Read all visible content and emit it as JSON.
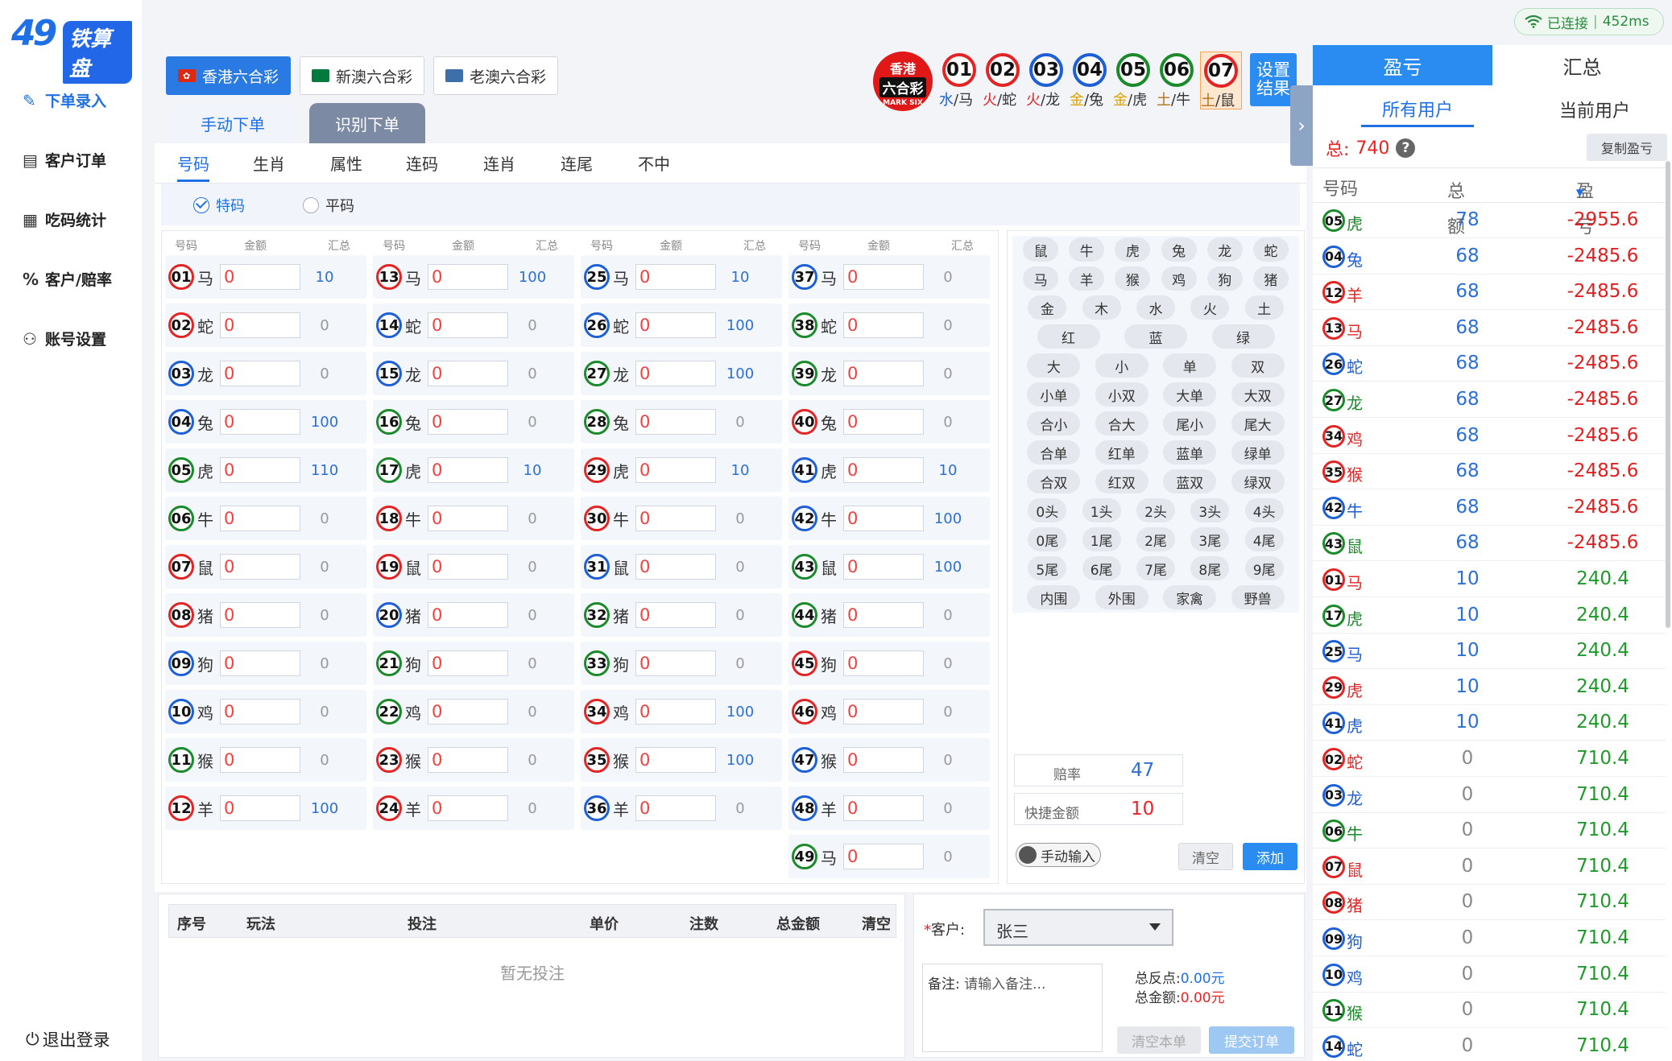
{
  "brand": {
    "logo_mark": "49",
    "logo_text": "铁算盘"
  },
  "nav": [
    {
      "label": "下单录入",
      "icon": "edit-icon"
    },
    {
      "label": "客户订单",
      "icon": "clipboard-icon"
    },
    {
      "label": "吃码统计",
      "icon": "chart-icon"
    },
    {
      "label": "客户/赔率",
      "icon": "percent-icon"
    },
    {
      "label": "账号设置",
      "icon": "user-icon"
    }
  ],
  "logout": "退出登录",
  "status": {
    "connected": "已连接",
    "latency": "452ms"
  },
  "lotteries": [
    "香港六合彩",
    "新澳六合彩",
    "老澳六合彩"
  ],
  "modes": [
    "手动下单",
    "识别下单"
  ],
  "draw": {
    "badge_top": "香港",
    "badge_mid": "六合彩",
    "badge_bottom": "MARK SIX",
    "balls": [
      {
        "n": "01",
        "c": "red",
        "e": "水",
        "z": "马"
      },
      {
        "n": "02",
        "c": "red",
        "e": "火",
        "z": "蛇"
      },
      {
        "n": "03",
        "c": "blue",
        "e": "火",
        "z": "龙"
      },
      {
        "n": "04",
        "c": "blue",
        "e": "金",
        "z": "兔"
      },
      {
        "n": "05",
        "c": "green",
        "e": "金",
        "z": "虎"
      },
      {
        "n": "06",
        "c": "green",
        "e": "土",
        "z": "牛"
      },
      {
        "n": "07",
        "c": "red",
        "e": "土",
        "z": "鼠"
      }
    ],
    "set_result": "设置结果"
  },
  "subtabs": [
    "号码",
    "生肖",
    "属性",
    "连码",
    "连肖",
    "连尾",
    "不中"
  ],
  "radios": [
    "特码",
    "平码"
  ],
  "grid": {
    "headers": [
      "号码",
      "金额",
      "汇总"
    ],
    "amount_default": "0",
    "columns": [
      [
        {
          "n": "01",
          "c": "red",
          "z": "马",
          "s": "10"
        },
        {
          "n": "02",
          "c": "red",
          "z": "蛇",
          "s": "0"
        },
        {
          "n": "03",
          "c": "blue",
          "z": "龙",
          "s": "0"
        },
        {
          "n": "04",
          "c": "blue",
          "z": "兔",
          "s": "100"
        },
        {
          "n": "05",
          "c": "green",
          "z": "虎",
          "s": "110"
        },
        {
          "n": "06",
          "c": "green",
          "z": "牛",
          "s": "0"
        },
        {
          "n": "07",
          "c": "red",
          "z": "鼠",
          "s": "0"
        },
        {
          "n": "08",
          "c": "red",
          "z": "猪",
          "s": "0"
        },
        {
          "n": "09",
          "c": "blue",
          "z": "狗",
          "s": "0"
        },
        {
          "n": "10",
          "c": "blue",
          "z": "鸡",
          "s": "0"
        },
        {
          "n": "11",
          "c": "green",
          "z": "猴",
          "s": "0"
        },
        {
          "n": "12",
          "c": "red",
          "z": "羊",
          "s": "100"
        }
      ],
      [
        {
          "n": "13",
          "c": "red",
          "z": "马",
          "s": "100"
        },
        {
          "n": "14",
          "c": "blue",
          "z": "蛇",
          "s": "0"
        },
        {
          "n": "15",
          "c": "blue",
          "z": "龙",
          "s": "0"
        },
        {
          "n": "16",
          "c": "green",
          "z": "兔",
          "s": "0"
        },
        {
          "n": "17",
          "c": "green",
          "z": "虎",
          "s": "10"
        },
        {
          "n": "18",
          "c": "red",
          "z": "牛",
          "s": "0"
        },
        {
          "n": "19",
          "c": "red",
          "z": "鼠",
          "s": "0"
        },
        {
          "n": "20",
          "c": "blue",
          "z": "猪",
          "s": "0"
        },
        {
          "n": "21",
          "c": "green",
          "z": "狗",
          "s": "0"
        },
        {
          "n": "22",
          "c": "green",
          "z": "鸡",
          "s": "0"
        },
        {
          "n": "23",
          "c": "red",
          "z": "猴",
          "s": "0"
        },
        {
          "n": "24",
          "c": "red",
          "z": "羊",
          "s": "0"
        }
      ],
      [
        {
          "n": "25",
          "c": "blue",
          "z": "马",
          "s": "10"
        },
        {
          "n": "26",
          "c": "blue",
          "z": "蛇",
          "s": "100"
        },
        {
          "n": "27",
          "c": "green",
          "z": "龙",
          "s": "100"
        },
        {
          "n": "28",
          "c": "green",
          "z": "兔",
          "s": "0"
        },
        {
          "n": "29",
          "c": "red",
          "z": "虎",
          "s": "10"
        },
        {
          "n": "30",
          "c": "red",
          "z": "牛",
          "s": "0"
        },
        {
          "n": "31",
          "c": "blue",
          "z": "鼠",
          "s": "0"
        },
        {
          "n": "32",
          "c": "green",
          "z": "猪",
          "s": "0"
        },
        {
          "n": "33",
          "c": "green",
          "z": "狗",
          "s": "0"
        },
        {
          "n": "34",
          "c": "red",
          "z": "鸡",
          "s": "100"
        },
        {
          "n": "35",
          "c": "red",
          "z": "猴",
          "s": "100"
        },
        {
          "n": "36",
          "c": "blue",
          "z": "羊",
          "s": "0"
        }
      ],
      [
        {
          "n": "37",
          "c": "blue",
          "z": "马",
          "s": "0"
        },
        {
          "n": "38",
          "c": "green",
          "z": "蛇",
          "s": "0"
        },
        {
          "n": "39",
          "c": "green",
          "z": "龙",
          "s": "0"
        },
        {
          "n": "40",
          "c": "red",
          "z": "兔",
          "s": "0"
        },
        {
          "n": "41",
          "c": "blue",
          "z": "虎",
          "s": "10"
        },
        {
          "n": "42",
          "c": "blue",
          "z": "牛",
          "s": "100"
        },
        {
          "n": "43",
          "c": "green",
          "z": "鼠",
          "s": "100"
        },
        {
          "n": "44",
          "c": "green",
          "z": "猪",
          "s": "0"
        },
        {
          "n": "45",
          "c": "red",
          "z": "狗",
          "s": "0"
        },
        {
          "n": "46",
          "c": "red",
          "z": "鸡",
          "s": "0"
        },
        {
          "n": "47",
          "c": "blue",
          "z": "猴",
          "s": "0"
        },
        {
          "n": "48",
          "c": "blue",
          "z": "羊",
          "s": "0"
        },
        {
          "n": "49",
          "c": "green",
          "z": "马",
          "s": "0"
        }
      ]
    ]
  },
  "quick": {
    "rows": [
      [
        "鼠",
        "牛",
        "虎",
        "兔",
        "龙",
        "蛇"
      ],
      [
        "马",
        "羊",
        "猴",
        "鸡",
        "狗",
        "猪"
      ],
      [
        "金",
        "木",
        "水",
        "火",
        "土"
      ],
      [
        "红",
        "蓝",
        "绿"
      ],
      [
        "大",
        "小",
        "单",
        "双"
      ],
      [
        "小单",
        "小双",
        "大单",
        "大双"
      ],
      [
        "合小",
        "合大",
        "尾小",
        "尾大"
      ],
      [
        "合单",
        "红单",
        "蓝单",
        "绿单"
      ],
      [
        "合双",
        "红双",
        "蓝双",
        "绿双"
      ],
      [
        "0头",
        "1头",
        "2头",
        "3头",
        "4头"
      ],
      [
        "0尾",
        "1尾",
        "2尾",
        "3尾",
        "4尾"
      ],
      [
        "5尾",
        "6尾",
        "7尾",
        "8尾",
        "9尾"
      ],
      [
        "内围",
        "外围",
        "家禽",
        "野兽"
      ]
    ],
    "odds_label": "赔率",
    "odds_value": "47",
    "quick_label": "快捷金额",
    "quick_value": "10",
    "manual_toggle": "手动输入",
    "clear": "清空",
    "add": "添加"
  },
  "bets": {
    "headers": [
      "序号",
      "玩法",
      "投注",
      "单价",
      "注数",
      "总金额",
      "清空"
    ],
    "empty": "暂无投注"
  },
  "order": {
    "customer_label": "客户:",
    "customer_value": "张三",
    "note_label": "备注:",
    "note_placeholder": "请输入备注...",
    "rebate_label": "总反点:",
    "rebate_value": "0.00元",
    "total_label": "总金额:",
    "total_value": "0.00元",
    "clear": "清空本单",
    "submit": "提交订单"
  },
  "right": {
    "tabs": [
      "盈亏",
      "汇总"
    ],
    "user_tabs": [
      "所有用户",
      "当前用户"
    ],
    "total_label": "总:",
    "total_value": "740",
    "copy": "复制盈亏",
    "headers": [
      "号码",
      "总额",
      "盈亏"
    ],
    "rows": [
      {
        "n": "05",
        "c": "green",
        "z": "虎",
        "t": "78",
        "p": "-2955.6"
      },
      {
        "n": "04",
        "c": "blue",
        "z": "兔",
        "t": "68",
        "p": "-2485.6"
      },
      {
        "n": "12",
        "c": "red",
        "z": "羊",
        "t": "68",
        "p": "-2485.6"
      },
      {
        "n": "13",
        "c": "red",
        "z": "马",
        "t": "68",
        "p": "-2485.6"
      },
      {
        "n": "26",
        "c": "blue",
        "z": "蛇",
        "t": "68",
        "p": "-2485.6"
      },
      {
        "n": "27",
        "c": "green",
        "z": "龙",
        "t": "68",
        "p": "-2485.6"
      },
      {
        "n": "34",
        "c": "red",
        "z": "鸡",
        "t": "68",
        "p": "-2485.6"
      },
      {
        "n": "35",
        "c": "red",
        "z": "猴",
        "t": "68",
        "p": "-2485.6"
      },
      {
        "n": "42",
        "c": "blue",
        "z": "牛",
        "t": "68",
        "p": "-2485.6"
      },
      {
        "n": "43",
        "c": "green",
        "z": "鼠",
        "t": "68",
        "p": "-2485.6"
      },
      {
        "n": "01",
        "c": "red",
        "z": "马",
        "t": "10",
        "p": "240.4"
      },
      {
        "n": "17",
        "c": "green",
        "z": "虎",
        "t": "10",
        "p": "240.4"
      },
      {
        "n": "25",
        "c": "blue",
        "z": "马",
        "t": "10",
        "p": "240.4"
      },
      {
        "n": "29",
        "c": "red",
        "z": "虎",
        "t": "10",
        "p": "240.4"
      },
      {
        "n": "41",
        "c": "blue",
        "z": "虎",
        "t": "10",
        "p": "240.4"
      },
      {
        "n": "02",
        "c": "red",
        "z": "蛇",
        "t": "0",
        "p": "710.4"
      },
      {
        "n": "03",
        "c": "blue",
        "z": "龙",
        "t": "0",
        "p": "710.4"
      },
      {
        "n": "06",
        "c": "green",
        "z": "牛",
        "t": "0",
        "p": "710.4"
      },
      {
        "n": "07",
        "c": "red",
        "z": "鼠",
        "t": "0",
        "p": "710.4"
      },
      {
        "n": "08",
        "c": "red",
        "z": "猪",
        "t": "0",
        "p": "710.4"
      },
      {
        "n": "09",
        "c": "blue",
        "z": "狗",
        "t": "0",
        "p": "710.4"
      },
      {
        "n": "10",
        "c": "blue",
        "z": "鸡",
        "t": "0",
        "p": "710.4"
      },
      {
        "n": "11",
        "c": "green",
        "z": "猴",
        "t": "0",
        "p": "710.4"
      },
      {
        "n": "14",
        "c": "blue",
        "z": "蛇",
        "t": "0",
        "p": "710.4"
      }
    ]
  },
  "colors": {
    "accent": "#2a8cf0",
    "red": "#e32424",
    "blue": "#1d5fd6",
    "green": "#1b8a2b",
    "loss": "#e02020",
    "profit": "#1f9a2a"
  }
}
